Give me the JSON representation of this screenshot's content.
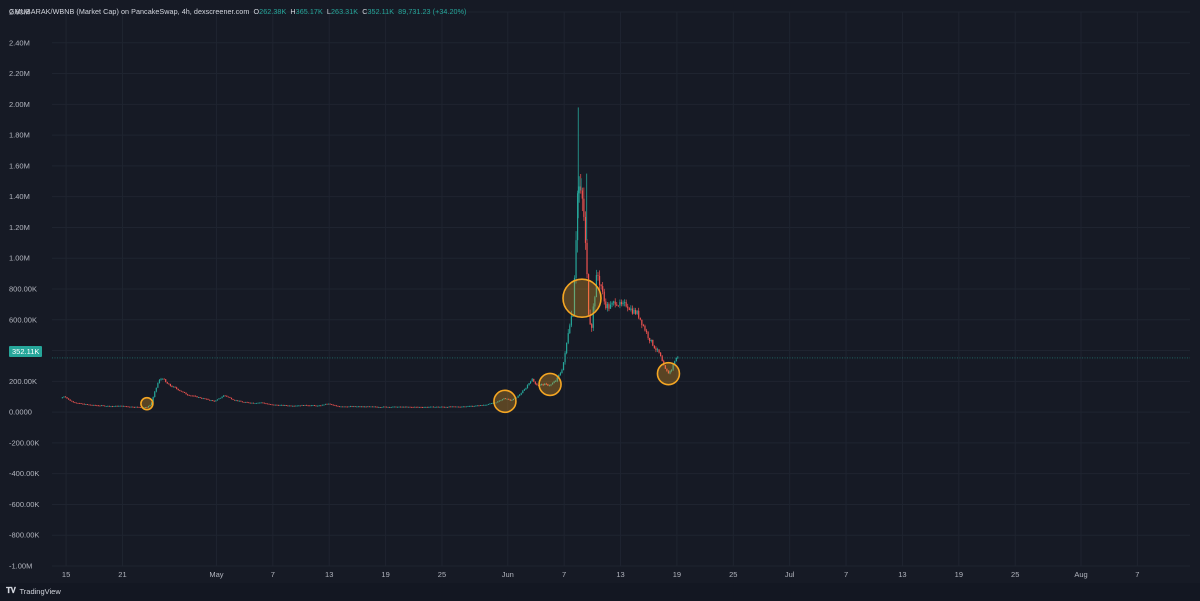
{
  "header": {
    "symbol": "GMUBARAK/WBNB (Market Cap) on PancakeSwap, 4h, dexscreener.com",
    "o_label": "O",
    "o_value": "262.38K",
    "h_label": "H",
    "h_value": "365.17K",
    "l_label": "L",
    "l_value": "263.31K",
    "c_label": "C",
    "c_value": "352.11K",
    "change": "89,731.23 (+34.20%)"
  },
  "last_price_label": "352.11K",
  "branding": {
    "logo_text": "TradingView",
    "logo_icon": "tradingview-logo-icon"
  },
  "colors": {
    "background": "#161a25",
    "grid": "#1f2430",
    "up": "#26a69a",
    "down": "#ef5350",
    "axis_text": "#b2b5be",
    "circle_stroke": "#f5a623",
    "circle_fill": "rgba(245,166,35,0.30)"
  },
  "chart_data": {
    "type": "candlestick",
    "title": "GMUBARAK/WBNB (Market Cap) on PancakeSwap, 4h, dexscreener.com",
    "xlabel": "",
    "ylabel": "",
    "ylim": [
      -1000000,
      2600000
    ],
    "xlim_days": [
      -1.5,
      119.6
    ],
    "y_ticks": [
      {
        "value": 2600000,
        "label": "2.60M"
      },
      {
        "value": 2400000,
        "label": "2.40M"
      },
      {
        "value": 2200000,
        "label": "2.20M"
      },
      {
        "value": 2000000,
        "label": "2.00M"
      },
      {
        "value": 1800000,
        "label": "1.80M"
      },
      {
        "value": 1600000,
        "label": "1.60M"
      },
      {
        "value": 1400000,
        "label": "1.40M"
      },
      {
        "value": 1200000,
        "label": "1.20M"
      },
      {
        "value": 1000000,
        "label": "1.00M"
      },
      {
        "value": 800000,
        "label": "800.00K"
      },
      {
        "value": 600000,
        "label": "600.00K"
      },
      {
        "value": 400000,
        "label": "400.00K"
      },
      {
        "value": 200000,
        "label": "200.00K"
      },
      {
        "value": 0,
        "label": "0.0000"
      },
      {
        "value": -200000,
        "label": "-200.00K"
      },
      {
        "value": -400000,
        "label": "-400.00K"
      },
      {
        "value": -600000,
        "label": "-600.00K"
      },
      {
        "value": -800000,
        "label": "-800.00K"
      },
      {
        "value": -1000000,
        "label": "-1.00M"
      }
    ],
    "x_ticks": [
      {
        "day": 0,
        "label": "15"
      },
      {
        "day": 6,
        "label": "21"
      },
      {
        "day": 16,
        "label": "May"
      },
      {
        "day": 22,
        "label": "7"
      },
      {
        "day": 28,
        "label": "13"
      },
      {
        "day": 34,
        "label": "19"
      },
      {
        "day": 40,
        "label": "25"
      },
      {
        "day": 47,
        "label": "Jun"
      },
      {
        "day": 53,
        "label": "7"
      },
      {
        "day": 59,
        "label": "13"
      },
      {
        "day": 65,
        "label": "19"
      },
      {
        "day": 71,
        "label": "25"
      },
      {
        "day": 77,
        "label": "Jul"
      },
      {
        "day": 83,
        "label": "7"
      },
      {
        "day": 89,
        "label": "13"
      },
      {
        "day": 95,
        "label": "19"
      },
      {
        "day": 101,
        "label": "25"
      },
      {
        "day": 108,
        "label": "Aug"
      },
      {
        "day": 114,
        "label": "7"
      }
    ],
    "price_path": [
      [
        -0.4,
        90000
      ],
      [
        0.0,
        105000
      ],
      [
        0.4,
        82000
      ],
      [
        0.8,
        68000
      ],
      [
        1.3,
        60000
      ],
      [
        2,
        52000
      ],
      [
        3,
        45000
      ],
      [
        4,
        42000
      ],
      [
        5,
        38000
      ],
      [
        6,
        40000
      ],
      [
        7,
        35000
      ],
      [
        8,
        32000
      ],
      [
        8.7,
        30000
      ],
      [
        9.2,
        50000
      ],
      [
        9.6,
        130000
      ],
      [
        10.0,
        200000
      ],
      [
        10.4,
        225000
      ],
      [
        10.8,
        190000
      ],
      [
        11.3,
        170000
      ],
      [
        12,
        150000
      ],
      [
        13,
        115000
      ],
      [
        14,
        100000
      ],
      [
        15,
        85000
      ],
      [
        16,
        70000
      ],
      [
        17,
        110000
      ],
      [
        18,
        80000
      ],
      [
        19,
        65000
      ],
      [
        20,
        60000
      ],
      [
        21,
        62000
      ],
      [
        22,
        48000
      ],
      [
        24,
        42000
      ],
      [
        26,
        45000
      ],
      [
        27,
        40000
      ],
      [
        28,
        55000
      ],
      [
        29,
        38000
      ],
      [
        31,
        36000
      ],
      [
        34,
        34000
      ],
      [
        38,
        33000
      ],
      [
        42,
        35000
      ],
      [
        44,
        42000
      ],
      [
        45,
        50000
      ],
      [
        46,
        65000
      ],
      [
        46.8,
        90000
      ],
      [
        47.5,
        75000
      ],
      [
        48.2,
        100000
      ],
      [
        49,
        150000
      ],
      [
        49.7,
        215000
      ],
      [
        50.3,
        175000
      ],
      [
        51,
        180000
      ],
      [
        51.7,
        175000
      ],
      [
        52.3,
        205000
      ],
      [
        52.9,
        270000
      ],
      [
        53.3,
        380000
      ],
      [
        53.7,
        580000
      ],
      [
        54.1,
        650000
      ],
      [
        54.4,
        1100000
      ],
      [
        54.65,
        1500000
      ],
      [
        54.9,
        1400000
      ],
      [
        55.2,
        1350000
      ],
      [
        55.5,
        1000000
      ],
      [
        55.8,
        620000
      ],
      [
        56.1,
        570000
      ],
      [
        56.4,
        760000
      ],
      [
        56.7,
        900000
      ],
      [
        57.1,
        820000
      ],
      [
        57.5,
        700000
      ],
      [
        58.0,
        680000
      ],
      [
        58.6,
        720000
      ],
      [
        59.2,
        690000
      ],
      [
        59.8,
        700000
      ],
      [
        60.4,
        660000
      ],
      [
        61.0,
        640000
      ],
      [
        61.6,
        560000
      ],
      [
        62.2,
        480000
      ],
      [
        62.8,
        420000
      ],
      [
        63.3,
        380000
      ],
      [
        63.8,
        290000
      ],
      [
        64.2,
        250000
      ],
      [
        64.6,
        280000
      ],
      [
        64.9,
        330000
      ],
      [
        65.1,
        352110
      ]
    ],
    "spikes": [
      {
        "day": 54.5,
        "high": 1980000
      },
      {
        "day": 55.4,
        "high": 1550000
      },
      {
        "day": 54.8,
        "high": 1520000
      }
    ],
    "last_close": 352110,
    "annotations": [
      {
        "type": "circle",
        "day": 8.6,
        "value": 55000,
        "size": "small"
      },
      {
        "type": "circle",
        "day": 46.7,
        "value": 70000,
        "size": "medium"
      },
      {
        "type": "circle",
        "day": 51.5,
        "value": 180000,
        "size": "medium"
      },
      {
        "type": "circle",
        "day": 54.9,
        "value": 740000,
        "size": "large"
      },
      {
        "type": "circle",
        "day": 64.1,
        "value": 250000,
        "size": "medium"
      }
    ]
  }
}
